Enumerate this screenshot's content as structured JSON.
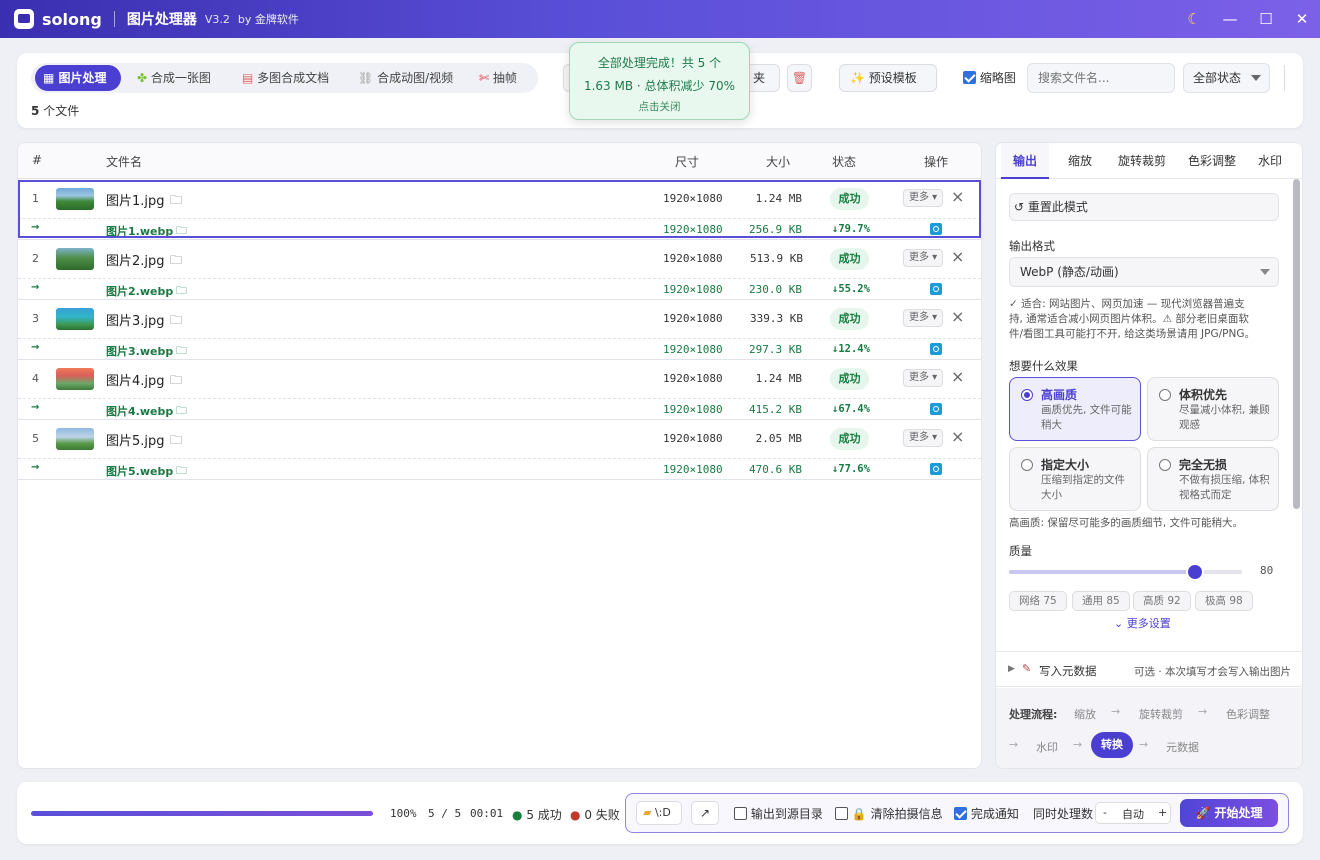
{
  "app": {
    "name": "solong",
    "title": "图片处理器",
    "version": "V3.2",
    "by": "by 金牌软件"
  },
  "window": {
    "moon_icon": "☾",
    "min_icon": "—",
    "max_icon": "☐",
    "close_icon": "✕"
  },
  "modes": [
    {
      "icon": "▦",
      "label": "图片处理"
    },
    {
      "icon": "✤",
      "label": "合成一张图"
    },
    {
      "icon": "▤",
      "label": "多图合成文档"
    },
    {
      "icon": "⛓",
      "label": "合成动图/视频"
    },
    {
      "icon": "✄",
      "label": "抽帧"
    }
  ],
  "toolbar": {
    "folder_btn": "夹",
    "trash_icon": "🗑",
    "preset_label": "✨ 预设模板",
    "thumbnail_label": "缩略图",
    "search_placeholder": "搜索文件名...",
    "status_filter": "全部状态",
    "file_count": "5",
    "file_count_suffix": "个文件"
  },
  "toast": {
    "line1": "全部处理完成！共 5 个",
    "line2": "1.63 MB · 总体积减少 70%",
    "line3": "点击关闭"
  },
  "table": {
    "headers": {
      "num": "#",
      "name": "文件名",
      "dims": "尺寸",
      "size": "大小",
      "status": "状态",
      "actions": "操作"
    },
    "more_label": "更多",
    "arrow": "→",
    "rows": [
      {
        "num": "1",
        "name": "图片1.jpg",
        "dims": "1920×1080",
        "size": "1.24 MB",
        "status": "成功",
        "out_name": "图片1.webp",
        "out_dims": "1920×1080",
        "out_size": "256.9 KB",
        "ratio": "↓79.7%"
      },
      {
        "num": "2",
        "name": "图片2.jpg",
        "dims": "1920×1080",
        "size": "513.9 KB",
        "status": "成功",
        "out_name": "图片2.webp",
        "out_dims": "1920×1080",
        "out_size": "230.0 KB",
        "ratio": "↓55.2%"
      },
      {
        "num": "3",
        "name": "图片3.jpg",
        "dims": "1920×1080",
        "size": "339.3 KB",
        "status": "成功",
        "out_name": "图片3.webp",
        "out_dims": "1920×1080",
        "out_size": "297.3 KB",
        "ratio": "↓12.4%"
      },
      {
        "num": "4",
        "name": "图片4.jpg",
        "dims": "1920×1080",
        "size": "1.24 MB",
        "status": "成功",
        "out_name": "图片4.webp",
        "out_dims": "1920×1080",
        "out_size": "415.2 KB",
        "ratio": "↓67.4%"
      },
      {
        "num": "5",
        "name": "图片5.jpg",
        "dims": "1920×1080",
        "size": "2.05 MB",
        "status": "成功",
        "out_name": "图片5.webp",
        "out_dims": "1920×1080",
        "out_size": "470.6 KB",
        "ratio": "↓77.6%"
      }
    ]
  },
  "right": {
    "tabs": [
      "输出",
      "缩放",
      "旋转裁剪",
      "色彩调整",
      "水印"
    ],
    "reset_label": "↺ 重置此模式",
    "format_label": "输出格式",
    "format_value": "WebP (静态/动画)",
    "desc1": "✓ 适合: 网站图片、网页加速 — 现代浏览器普遍支",
    "desc2": "持, 通常适合减小网页图片体积。⚠ 部分老旧桌面软",
    "desc3": "件/看图工具可能打不开, 给这类场景请用 JPG/PNG。",
    "effect_label": "想要什么效果",
    "options": [
      {
        "title": "高画质",
        "desc": "画质优先, 文件可能稍大"
      },
      {
        "title": "体积优先",
        "desc": "尽量减小体积, 兼顾观感"
      },
      {
        "title": "指定大小",
        "desc": "压缩到指定的文件大小"
      },
      {
        "title": "完全无损",
        "desc": "不做有损压缩, 体积视格式而定"
      }
    ],
    "effect_note": "高画质: 保留尽可能多的画质细节, 文件可能稍大。",
    "quality_label": "质量",
    "quality_value": "80",
    "quality_level": 0.8,
    "chips": [
      "网络 75",
      "通用 85",
      "高质 92",
      "极高 98"
    ],
    "more_settings": "⌄ 更多设置",
    "metadata_label": "写入元数据",
    "metadata_note": "可选 · 本次填写才会写入输出图片",
    "pipeline_label": "处理流程:",
    "pipeline": [
      "缩放",
      "旋转裁剪",
      "色彩调整",
      "水印",
      "转换",
      "元数据"
    ]
  },
  "bottom": {
    "progress": 1.0,
    "percent": "100%",
    "count": "5 / 5",
    "time": "00:01",
    "success": "5 成功",
    "fail": "0 失败",
    "output_dir": "\\:D",
    "open_icon": "↗",
    "to_source": "输出到源目录",
    "clear_exif": "🔒 清除拍摄信息",
    "notify": "完成通知",
    "concurrent_label": "同时处理数",
    "minus": "-",
    "concurrent_value": "自动",
    "plus": "+",
    "start_label": "🚀 开始处理"
  },
  "colors": {
    "accent": "#4b3fd1",
    "success": "#18803f",
    "fail": "#c0392b"
  }
}
